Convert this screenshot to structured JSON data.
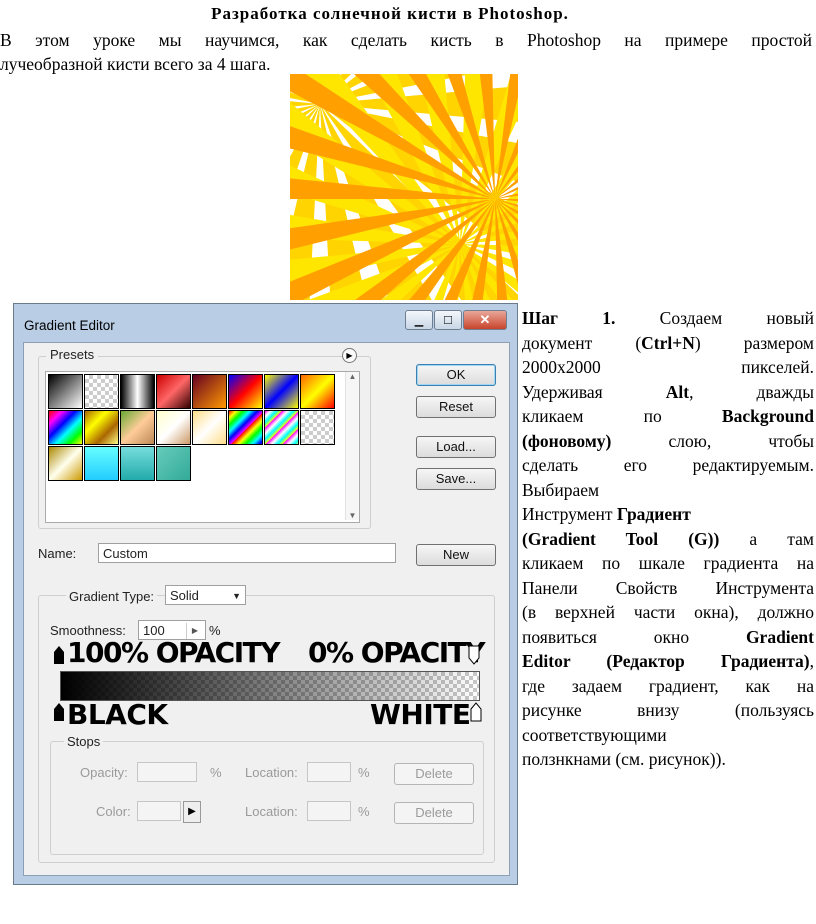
{
  "doc": {
    "title": "Разработка солнечной кисти в Photoshop.",
    "intro_line1": "В этом уроке мы научимся, как сделать кисть в Photoshop на примере простой",
    "intro_line2": "лучеобразной кисти всего за 4 шага.",
    "step": [
      {
        "b": "Шаг 1.",
        "t": " Создаем новый",
        "j": true
      },
      {
        "t": "документ (",
        "b2": "Ctrl+N",
        "t2": ") размером",
        "j": true
      },
      {
        "t": "2000х2000 пикселей.",
        "j": true
      },
      {
        "t": "Удерживая ",
        "b": "Alt",
        "t2": ", дважды",
        "j": true
      },
      {
        "t": "кликаем по ",
        "b": "Background",
        "j": true
      },
      {
        "b": "(фоновому)",
        "t": " слою, чтобы",
        "j": true
      },
      {
        "t": "сделать его редактируемым.",
        "j": true
      },
      {
        "t": "Выбираем",
        "j": false
      },
      {
        "t": "Инструмент ",
        "b": "Градиент",
        "j": false
      },
      {
        "b": "(Gradient Tool (G))",
        "t": " а там",
        "j": true
      },
      {
        "t": "кликаем по шкале градиента на",
        "j": true
      },
      {
        "t": "Панели Свойств Инструмента",
        "j": true
      },
      {
        "t": "(в верхней части окна), должно",
        "j": true
      },
      {
        "t": "появиться окно ",
        "b": "Gradient",
        "j": true
      },
      {
        "b": "Editor (Редактор Градиента)",
        "t": ",",
        "j": true
      },
      {
        "t": "где задаем градиент, как на",
        "j": true
      },
      {
        "t": "рисунке внизу (пользуясь",
        "j": true
      },
      {
        "t": "соответствующими",
        "j": false
      },
      {
        "t": "ползнкнами (см. рисунок)).",
        "j": false
      }
    ]
  },
  "dialog": {
    "title": "Gradient Editor",
    "presets_label": "Presets",
    "buttons": {
      "ok": "OK",
      "reset": "Reset",
      "load": "Load...",
      "save": "Save...",
      "new": "New",
      "delete": "Delete"
    },
    "name_label": "Name:",
    "name_value": "Custom",
    "gradient_group": "",
    "gradient_type_label": "Gradient Type:",
    "gradient_type_value": "Solid",
    "smoothness_label": "Smoothness:",
    "smoothness_value": "100",
    "smoothness_unit": "%",
    "opacity_left": "100% OPACITY",
    "opacity_right": "0% OPACITY",
    "color_left": "BLACK",
    "color_right": "WHITE",
    "stops_label": "Stops",
    "stops_opacity_label": "Opacity:",
    "stops_color_label": "Color:",
    "location_label": "Location:",
    "pct": "%",
    "presets": [
      "linear-gradient(135deg,#000,#fff)",
      "repeating-conic-gradient(#ccc 0 25%,#fff 0 50%)",
      "linear-gradient(90deg,#000,#fff,#000)",
      "linear-gradient(135deg,#c00,#f66,#300)",
      "linear-gradient(135deg,#602,#f90)",
      "linear-gradient(135deg,#00f,#f00,#ff0)",
      "linear-gradient(135deg,#ff0,#00f,#ff0)",
      "linear-gradient(135deg,#f60,#ff0,#f00)",
      "linear-gradient(135deg,#f00,#f0f,#00f,#0ff,#0f0,#ff0)",
      "linear-gradient(135deg,#a60,#ff0,#a60,#ff8)",
      "linear-gradient(135deg,#6a3,#fc9,#b85)",
      "linear-gradient(135deg,#ffc,#fff,#c96)",
      "linear-gradient(135deg,#fd8,#fff,#fd8)",
      "repeating-linear-gradient(135deg,#f00,#ff0 5px,#0f0 10px,#0ff 15px,#00f 20px,#f0f 25px)",
      "repeating-linear-gradient(135deg,#f0f,#fff 4px,#0ff 8px,#ff0 12px)",
      "repeating-conic-gradient(#ccc 0 25%,#fff 0 50%)",
      "linear-gradient(135deg,#a80,#ffe,#c90)",
      "linear-gradient(180deg,#6ff,#2cf)",
      "linear-gradient(180deg,#7dd,#2aa)",
      "linear-gradient(135deg,#6cb,#3a9)"
    ]
  }
}
